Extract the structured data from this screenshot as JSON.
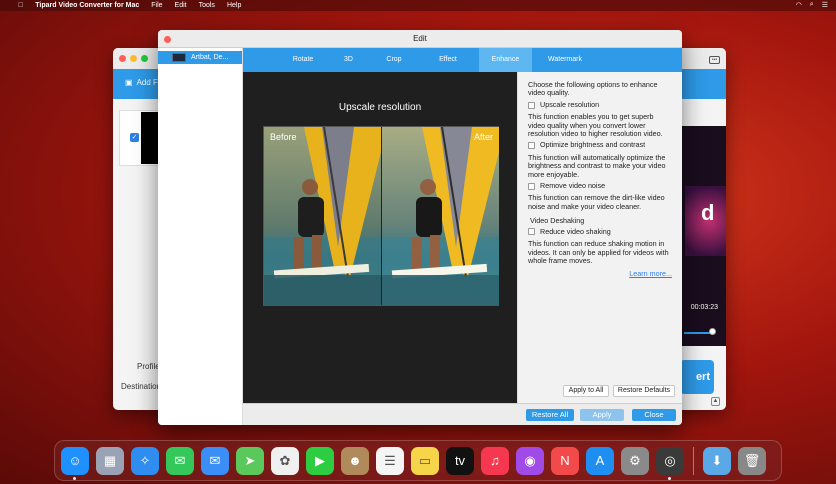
{
  "menubar": {
    "app_name": "Tipard Video Converter for Mac",
    "items": [
      "File",
      "Edit",
      "Tools",
      "Help"
    ]
  },
  "back_window": {
    "add_files_label": "Add F",
    "profile_label": "Profile",
    "destination_label": "Destination",
    "preview_text": "d",
    "time": "00:03:23",
    "convert_label": "ert"
  },
  "edit_window": {
    "title": "Edit",
    "file_item_label": "Artbat, De...",
    "tabs": [
      {
        "label": "Rotate",
        "active": false
      },
      {
        "label": "3D",
        "active": false
      },
      {
        "label": "Crop",
        "active": false
      },
      {
        "label": "Effect",
        "active": false
      },
      {
        "label": "Enhance",
        "active": true
      },
      {
        "label": "Watermark",
        "active": false
      }
    ],
    "stage": {
      "heading": "Upscale resolution",
      "before_label": "Before",
      "after_label": "After"
    },
    "enhance": {
      "intro": "Choose the following options to enhance video quality.",
      "options": [
        {
          "label": "Upscale resolution",
          "checked": false,
          "desc": "This function enables you to get superb video quality when you convert lower resolution video to higher resolution video."
        },
        {
          "label": "Optimize brightness and contrast",
          "checked": false,
          "desc": "This function will automatically optimize the brightness and contrast to make your video more enjoyable."
        },
        {
          "label": "Remove video noise",
          "checked": false,
          "desc": "This function can remove the dirt-like video noise and make your video cleaner."
        }
      ],
      "deshake_section": "Video Deshaking",
      "deshake_option": {
        "label": "Reduce video shaking",
        "checked": false,
        "desc": "This function can reduce shaking motion in videos. It can only be applied for videos with whole frame moves."
      },
      "learn_more": "Learn more...",
      "apply_to_all": "Apply to All",
      "restore_defaults": "Restore Defaults"
    },
    "footer": {
      "restore_all": "Restore All",
      "apply": "Apply",
      "close": "Close"
    }
  },
  "dock": {
    "apps": [
      {
        "name": "finder-icon",
        "glyph": "☺",
        "color": "#1e90ff",
        "running": true
      },
      {
        "name": "launchpad-icon",
        "glyph": "▦",
        "color": "#9aa3b5",
        "running": false
      },
      {
        "name": "safari-icon",
        "glyph": "✧",
        "color": "#2f8df0",
        "running": false
      },
      {
        "name": "messages-icon",
        "glyph": "✉",
        "color": "#34c759",
        "running": false
      },
      {
        "name": "mail-icon",
        "glyph": "✉",
        "color": "#3a8ef5",
        "running": false
      },
      {
        "name": "maps-icon",
        "glyph": "➤",
        "color": "#5ac85a",
        "running": false
      },
      {
        "name": "photos-icon",
        "glyph": "✿",
        "color": "#f0f0f0",
        "running": false
      },
      {
        "name": "facetime-icon",
        "glyph": "▶",
        "color": "#2ecc40",
        "running": false
      },
      {
        "name": "contacts-icon",
        "glyph": "☻",
        "color": "#b08a5a",
        "running": false
      },
      {
        "name": "reminders-icon",
        "glyph": "☰",
        "color": "#f5f5f5",
        "running": false
      },
      {
        "name": "notes-icon",
        "glyph": "▭",
        "color": "#f7d54a",
        "running": false
      },
      {
        "name": "apple-tv-icon",
        "glyph": "tv",
        "color": "#111111",
        "running": false
      },
      {
        "name": "music-icon",
        "glyph": "♫",
        "color": "#f5384f",
        "running": false
      },
      {
        "name": "podcasts-icon",
        "glyph": "◉",
        "color": "#a04ae8",
        "running": false
      },
      {
        "name": "news-icon",
        "glyph": "N",
        "color": "#f24a4a",
        "running": false
      },
      {
        "name": "app-store-icon",
        "glyph": "A",
        "color": "#1f8ef1",
        "running": false
      },
      {
        "name": "system-preferences-icon",
        "glyph": "⚙",
        "color": "#8a8a8a",
        "running": false
      },
      {
        "name": "video-converter-icon",
        "glyph": "◎",
        "color": "#3a3a3a",
        "running": true
      }
    ],
    "trailing": [
      {
        "name": "downloads-folder-icon",
        "glyph": "⬇",
        "color": "#5aa9e6"
      },
      {
        "name": "trash-icon",
        "glyph": "🗑",
        "color": "#888888"
      }
    ]
  }
}
